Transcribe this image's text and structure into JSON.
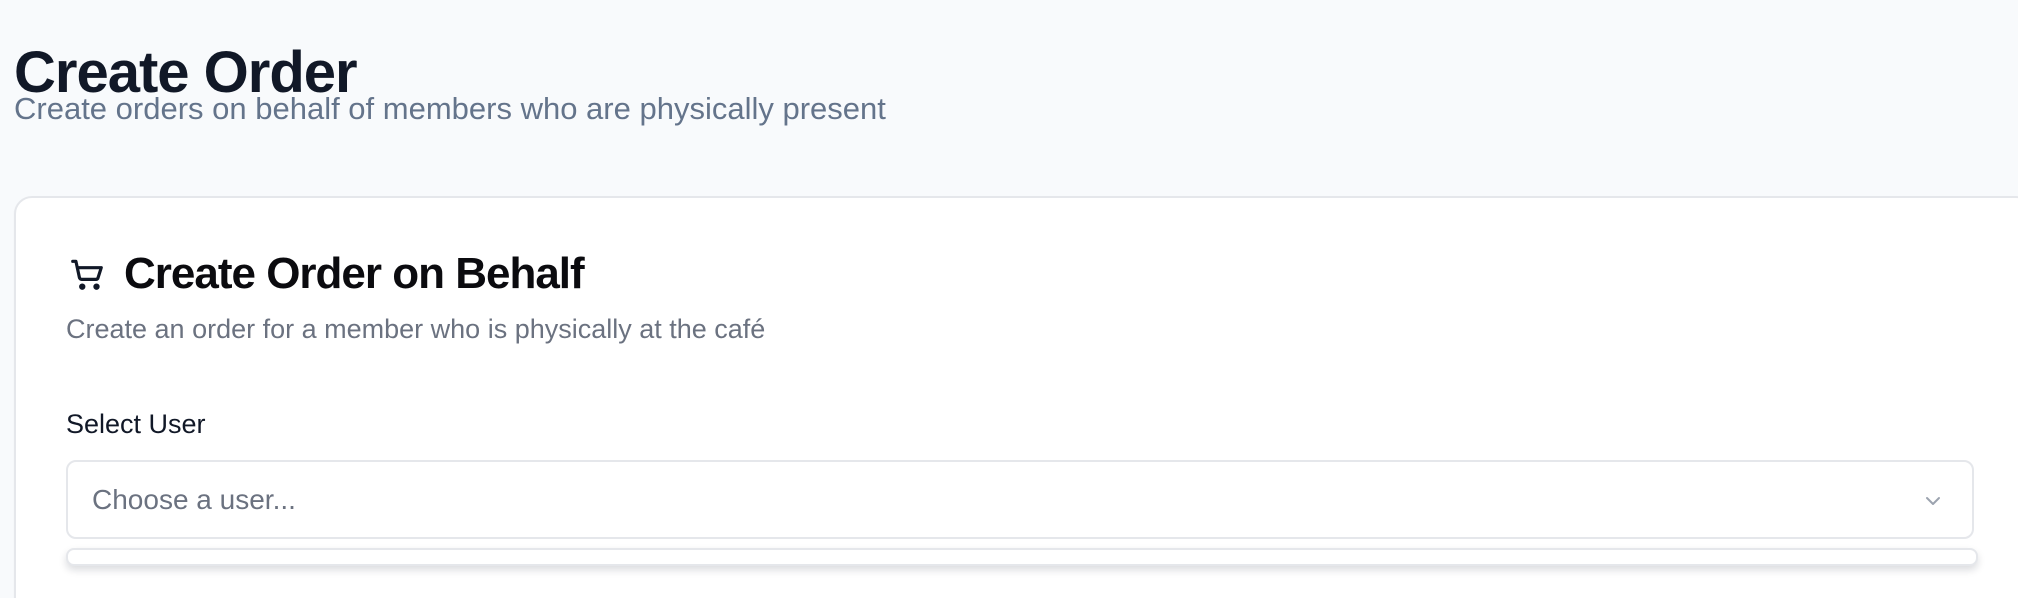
{
  "page": {
    "title": "Create Order",
    "subtitle": "Create orders on behalf of members who are physically present"
  },
  "card": {
    "icon": "shopping-cart-icon",
    "title": "Create Order on Behalf",
    "subtitle": "Create an order for a member who is physically at the café"
  },
  "select_user": {
    "label": "Select User",
    "placeholder": "Choose a user...",
    "icon": "chevron-down-icon"
  },
  "colors": {
    "background": "#f8fafc",
    "card": "#ffffff",
    "border": "#e5e7eb",
    "muted_text": "#6b7280",
    "primary_text": "#111827"
  }
}
